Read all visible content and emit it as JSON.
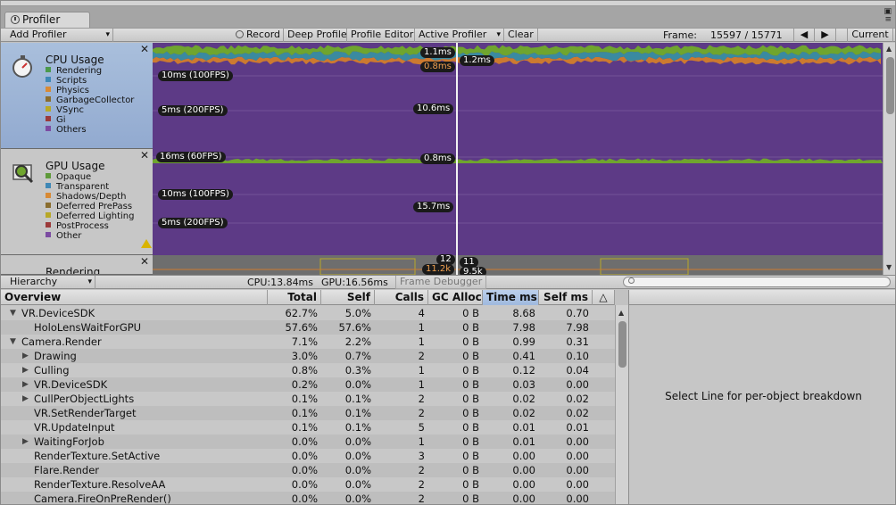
{
  "window": {
    "tab_title": "Profiler"
  },
  "toolbar": {
    "add_profiler": "Add Profiler",
    "record": "Record",
    "deep_profile": "Deep Profile",
    "profile_editor": "Profile Editor",
    "active_profiler": "Active Profiler",
    "clear": "Clear",
    "frame_label": "Frame:",
    "frame_value": "15597 / 15771",
    "prev": "◀",
    "next": "▶",
    "current": "Current"
  },
  "cpu_panel": {
    "title": "CPU Usage",
    "items": [
      {
        "label": "Rendering",
        "color": "#4c9a4c"
      },
      {
        "label": "Scripts",
        "color": "#3f88b6"
      },
      {
        "label": "Physics",
        "color": "#d88a35"
      },
      {
        "label": "GarbageCollector",
        "color": "#8a6d2e"
      },
      {
        "label": "VSync",
        "color": "#b8a828"
      },
      {
        "label": "Gi",
        "color": "#9c3a3a"
      },
      {
        "label": "Others",
        "color": "#7c4ca2"
      }
    ],
    "labels": {
      "l10ms": "10ms (100FPS)",
      "l5ms": "5ms (200FPS)",
      "sel1": "1.1ms",
      "sel2": "0.8ms",
      "sel3": "1.2ms",
      "sel4": "10.6ms"
    }
  },
  "gpu_panel": {
    "title": "GPU Usage",
    "items": [
      {
        "label": "Opaque",
        "color": "#5e9a3a"
      },
      {
        "label": "Transparent",
        "color": "#3f88b6"
      },
      {
        "label": "Shadows/Depth",
        "color": "#d88a35"
      },
      {
        "label": "Deferred PrePass",
        "color": "#8a6d2e"
      },
      {
        "label": "Deferred Lighting",
        "color": "#b8a828"
      },
      {
        "label": "PostProcess",
        "color": "#9c3a3a"
      },
      {
        "label": "Other",
        "color": "#7c4ca2"
      }
    ],
    "labels": {
      "l16ms": "16ms (60FPS)",
      "l10ms": "10ms (100FPS)",
      "l5ms": "5ms (200FPS)",
      "sel1": "0.8ms",
      "sel2": "15.7ms"
    }
  },
  "rendering_panel": {
    "title": "Rendering",
    "labels": {
      "a": "12",
      "b": "11.2k",
      "c": "11",
      "d": "9.5k"
    }
  },
  "colors": {
    "purple": "#5d3a86",
    "green": "#6fa52e",
    "olive": "#8a9a30",
    "orange": "#cc7a30",
    "teal": "#3a8aa0"
  },
  "bottom": {
    "view": "Hierarchy",
    "cpu": "CPU:13.84ms",
    "gpu": "GPU:16.56ms",
    "frame_debugger": "Frame Debugger"
  },
  "table": {
    "headers": {
      "overview": "Overview",
      "total": "Total",
      "self": "Self",
      "calls": "Calls",
      "gc": "GC Alloc",
      "time": "Time ms",
      "selfms": "Self ms"
    },
    "rows": [
      {
        "name": "VR.DeviceSDK",
        "total": "62.7%",
        "self": "5.0%",
        "calls": "4",
        "gc": "0 B",
        "time": "8.68",
        "selfms": "0.70"
      },
      {
        "name": "HoloLensWaitForGPU",
        "total": "57.6%",
        "self": "57.6%",
        "calls": "1",
        "gc": "0 B",
        "time": "7.98",
        "selfms": "7.98"
      },
      {
        "name": "Camera.Render",
        "total": "7.1%",
        "self": "2.2%",
        "calls": "1",
        "gc": "0 B",
        "time": "0.99",
        "selfms": "0.31"
      },
      {
        "name": "Drawing",
        "total": "3.0%",
        "self": "0.7%",
        "calls": "2",
        "gc": "0 B",
        "time": "0.41",
        "selfms": "0.10"
      },
      {
        "name": "Culling",
        "total": "0.8%",
        "self": "0.3%",
        "calls": "1",
        "gc": "0 B",
        "time": "0.12",
        "selfms": "0.04"
      },
      {
        "name": "VR.DeviceSDK",
        "total": "0.2%",
        "self": "0.0%",
        "calls": "1",
        "gc": "0 B",
        "time": "0.03",
        "selfms": "0.00"
      },
      {
        "name": "CullPerObjectLights",
        "total": "0.1%",
        "self": "0.1%",
        "calls": "2",
        "gc": "0 B",
        "time": "0.02",
        "selfms": "0.02"
      },
      {
        "name": "VR.SetRenderTarget",
        "total": "0.1%",
        "self": "0.1%",
        "calls": "2",
        "gc": "0 B",
        "time": "0.02",
        "selfms": "0.02"
      },
      {
        "name": "VR.UpdateInput",
        "total": "0.1%",
        "self": "0.1%",
        "calls": "5",
        "gc": "0 B",
        "time": "0.01",
        "selfms": "0.01"
      },
      {
        "name": "WaitingForJob",
        "total": "0.0%",
        "self": "0.0%",
        "calls": "1",
        "gc": "0 B",
        "time": "0.01",
        "selfms": "0.00"
      },
      {
        "name": "RenderTexture.SetActive",
        "total": "0.0%",
        "self": "0.0%",
        "calls": "3",
        "gc": "0 B",
        "time": "0.00",
        "selfms": "0.00"
      },
      {
        "name": "Flare.Render",
        "total": "0.0%",
        "self": "0.0%",
        "calls": "2",
        "gc": "0 B",
        "time": "0.00",
        "selfms": "0.00"
      },
      {
        "name": "RenderTexture.ResolveAA",
        "total": "0.0%",
        "self": "0.0%",
        "calls": "2",
        "gc": "0 B",
        "time": "0.00",
        "selfms": "0.00"
      },
      {
        "name": "Camera.FireOnPreRender()",
        "total": "0.0%",
        "self": "0.0%",
        "calls": "2",
        "gc": "0 B",
        "time": "0.00",
        "selfms": "0.00"
      }
    ]
  },
  "detail": {
    "message": "Select Line for per-object breakdown"
  }
}
